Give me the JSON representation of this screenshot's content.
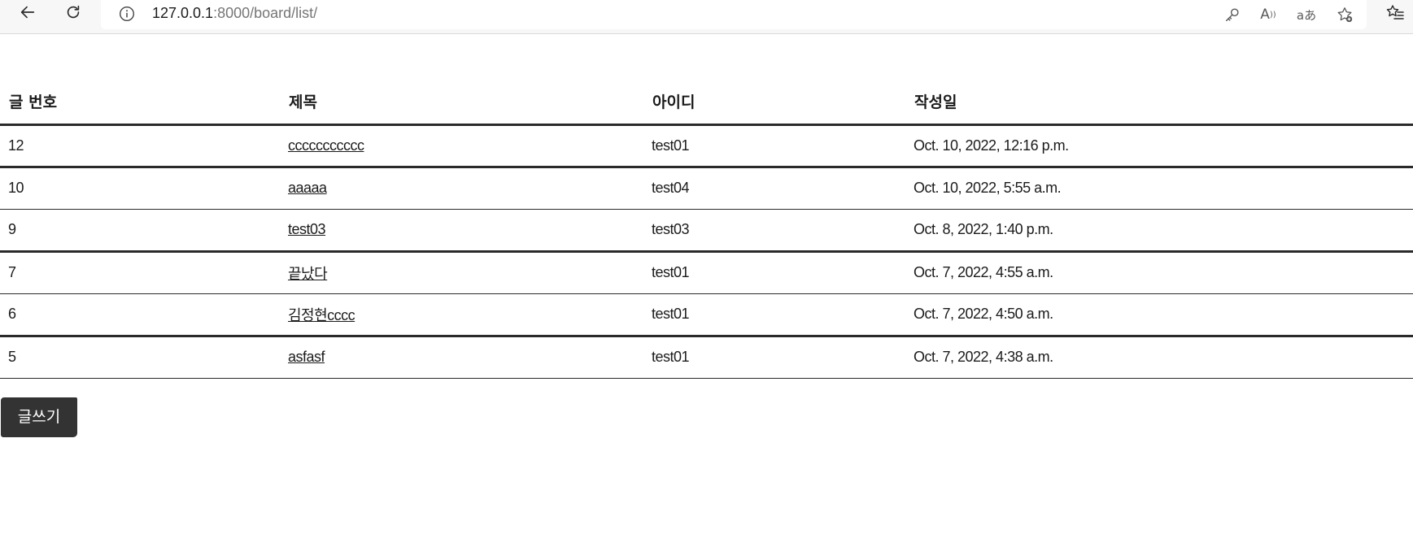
{
  "browser": {
    "url_host": "127.0.0.1",
    "url_rest": ":8000/board/list/",
    "read_aloud_icon_text": "A",
    "translate_icon_text": "aあ"
  },
  "board": {
    "headers": {
      "no": "글 번호",
      "title": "제목",
      "user_id": "아이디",
      "created": "작성일"
    },
    "rows": [
      {
        "no": "12",
        "title": "ccccccccccc",
        "user_id": "test01",
        "created": "Oct. 10, 2022, 12:16 p.m."
      },
      {
        "no": "10",
        "title": "aaaaa",
        "user_id": "test04",
        "created": "Oct. 10, 2022, 5:55 a.m."
      },
      {
        "no": "9",
        "title": "test03",
        "user_id": "test03",
        "created": "Oct. 8, 2022, 1:40 p.m."
      },
      {
        "no": "7",
        "title": "끝났다",
        "user_id": "test01",
        "created": "Oct. 7, 2022, 4:55 a.m."
      },
      {
        "no": "6",
        "title": "김정현cccc",
        "user_id": "test01",
        "created": "Oct. 7, 2022, 4:50 a.m."
      },
      {
        "no": "5",
        "title": "asfasf",
        "user_id": "test01",
        "created": "Oct. 7, 2022, 4:38 a.m."
      }
    ],
    "write_button_label": "글쓰기"
  }
}
